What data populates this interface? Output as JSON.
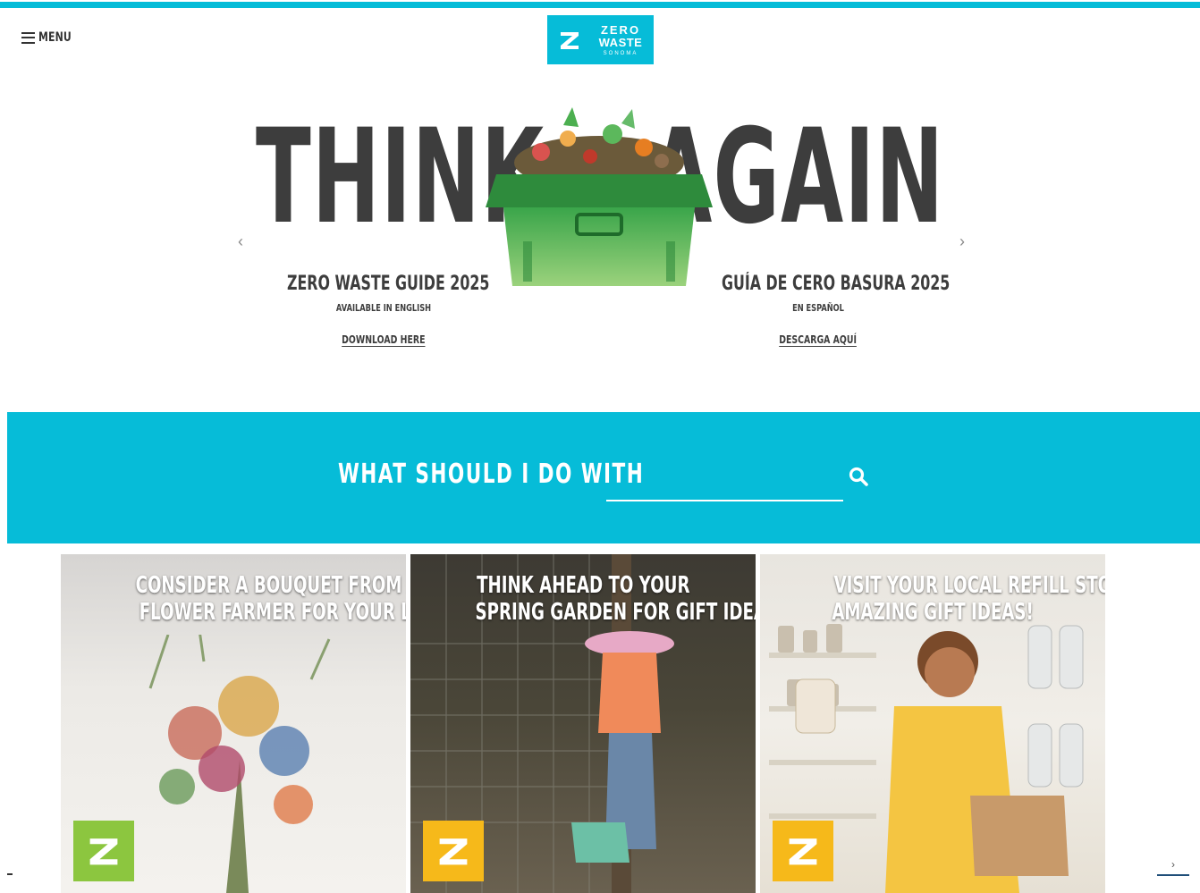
{
  "brand": {
    "logo_line1": "ZERO",
    "logo_line2": "WASTE",
    "logo_line3": "SONOMA",
    "accent": "#06bcd8"
  },
  "header": {
    "menu_label": "MENU"
  },
  "hero": {
    "headline_left": "THINK",
    "headline_right": "AGAIN",
    "guide_en": {
      "title": "ZERO WASTE GUIDE 2025",
      "subtitle": "AVAILABLE IN ENGLISH",
      "link": "DOWNLOAD HERE"
    },
    "guide_es": {
      "title": "GUÍA DE CERO BASURA 2025",
      "subtitle": "EN ESPAÑOL",
      "link": "DESCARGA AQUÍ"
    },
    "prev_icon": "chevron-left-icon",
    "next_icon": "chevron-right-icon"
  },
  "search": {
    "label": "WHAT SHOULD I DO WITH",
    "value": "",
    "placeholder": ""
  },
  "gallery": {
    "cards": [
      {
        "line1": "CONSIDER A BOUQUET FROM A LOCAL",
        "line2": "FLOWER FARMER FOR YOUR LOVED ONE",
        "badge_color": "#8cc63f"
      },
      {
        "line1": "THINK AHEAD TO YOUR",
        "line2": "SPRING GARDEN FOR GIFT IDEAS",
        "badge_color": "#f6b91a"
      },
      {
        "line1": "VISIT YOUR LOCAL REFILL STORE FOR",
        "line2": "AMAZING GIFT IDEAS!",
        "badge_color": "#f6b91a"
      }
    ],
    "next_label": "›"
  }
}
